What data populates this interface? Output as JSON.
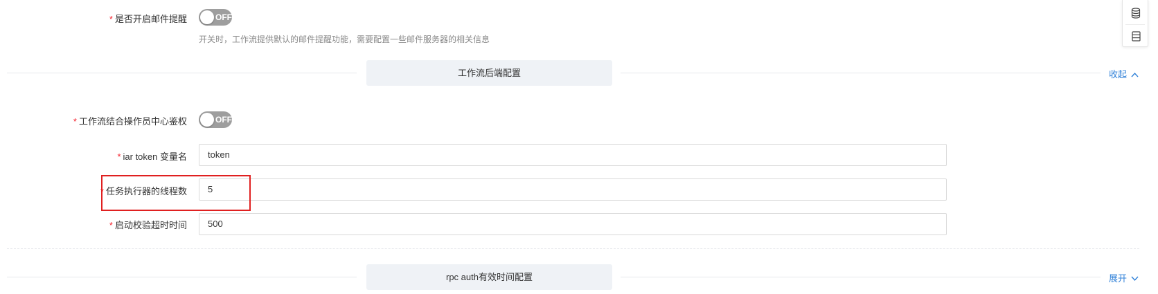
{
  "email_reminder": {
    "label": "是否开启邮件提醒",
    "switch_text": "OFF",
    "hint": "开关时，工作流提供默认的邮件提醒功能，需要配置一些邮件服务器的相关信息"
  },
  "section_backend": {
    "title": "工作流后端配置",
    "toggle": "收起"
  },
  "fields": {
    "auth_switch": {
      "label": "工作流结合操作员中心鉴权",
      "switch_text": "OFF"
    },
    "iar_token": {
      "label": "iar token 变量名",
      "value": "token"
    },
    "threads": {
      "label": "任务执行器的线程数",
      "value": "5"
    },
    "timeout": {
      "label": "启动校验超时时间",
      "value": "500"
    }
  },
  "section_rpc": {
    "title": "rpc auth有效时间配置",
    "toggle": "展开"
  },
  "required_mark": "*",
  "icons": {
    "collapse": "chevron-up-icon",
    "expand": "chevron-down-icon",
    "panel_top": "database-icon",
    "panel_bottom": "table-icon"
  },
  "colors": {
    "accent": "#2f80d8",
    "required": "#f5222d",
    "highlight": "#e02020",
    "switch_off": "#9e9e9e"
  }
}
